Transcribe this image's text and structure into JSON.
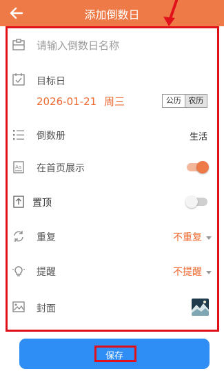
{
  "header": {
    "title": "添加倒数日",
    "background_color": "#ee7a48",
    "back_icon": "arrow-left-icon"
  },
  "name_input": {
    "placeholder": "请输入倒数日名称",
    "icon": "clipboard-icon"
  },
  "target_date": {
    "label": "目标日",
    "date": "2026-01-21",
    "weekday": "周三",
    "calendar_options": [
      "公历",
      "农历"
    ],
    "selected_calendar": "农历",
    "icon": "calendar-check-icon"
  },
  "book": {
    "label": "倒数册",
    "value": "生活",
    "icon": "list-icon"
  },
  "show_home": {
    "label": "在首页展示",
    "enabled": true,
    "icon": "image-card-icon"
  },
  "pin_top": {
    "label": "置顶",
    "enabled": false,
    "icon": "upload-box-icon"
  },
  "repeat": {
    "label": "重复",
    "value": "不重复",
    "icon": "refresh-icon"
  },
  "reminder": {
    "label": "提醒",
    "value": "不提醒",
    "icon": "lightbulb-icon"
  },
  "cover": {
    "label": "封面",
    "icon": "picture-icon"
  },
  "save": {
    "label": "保存",
    "color": "#2f8ef5"
  },
  "accent_color": "#ee6a30",
  "annotation_color": "#e1111b"
}
